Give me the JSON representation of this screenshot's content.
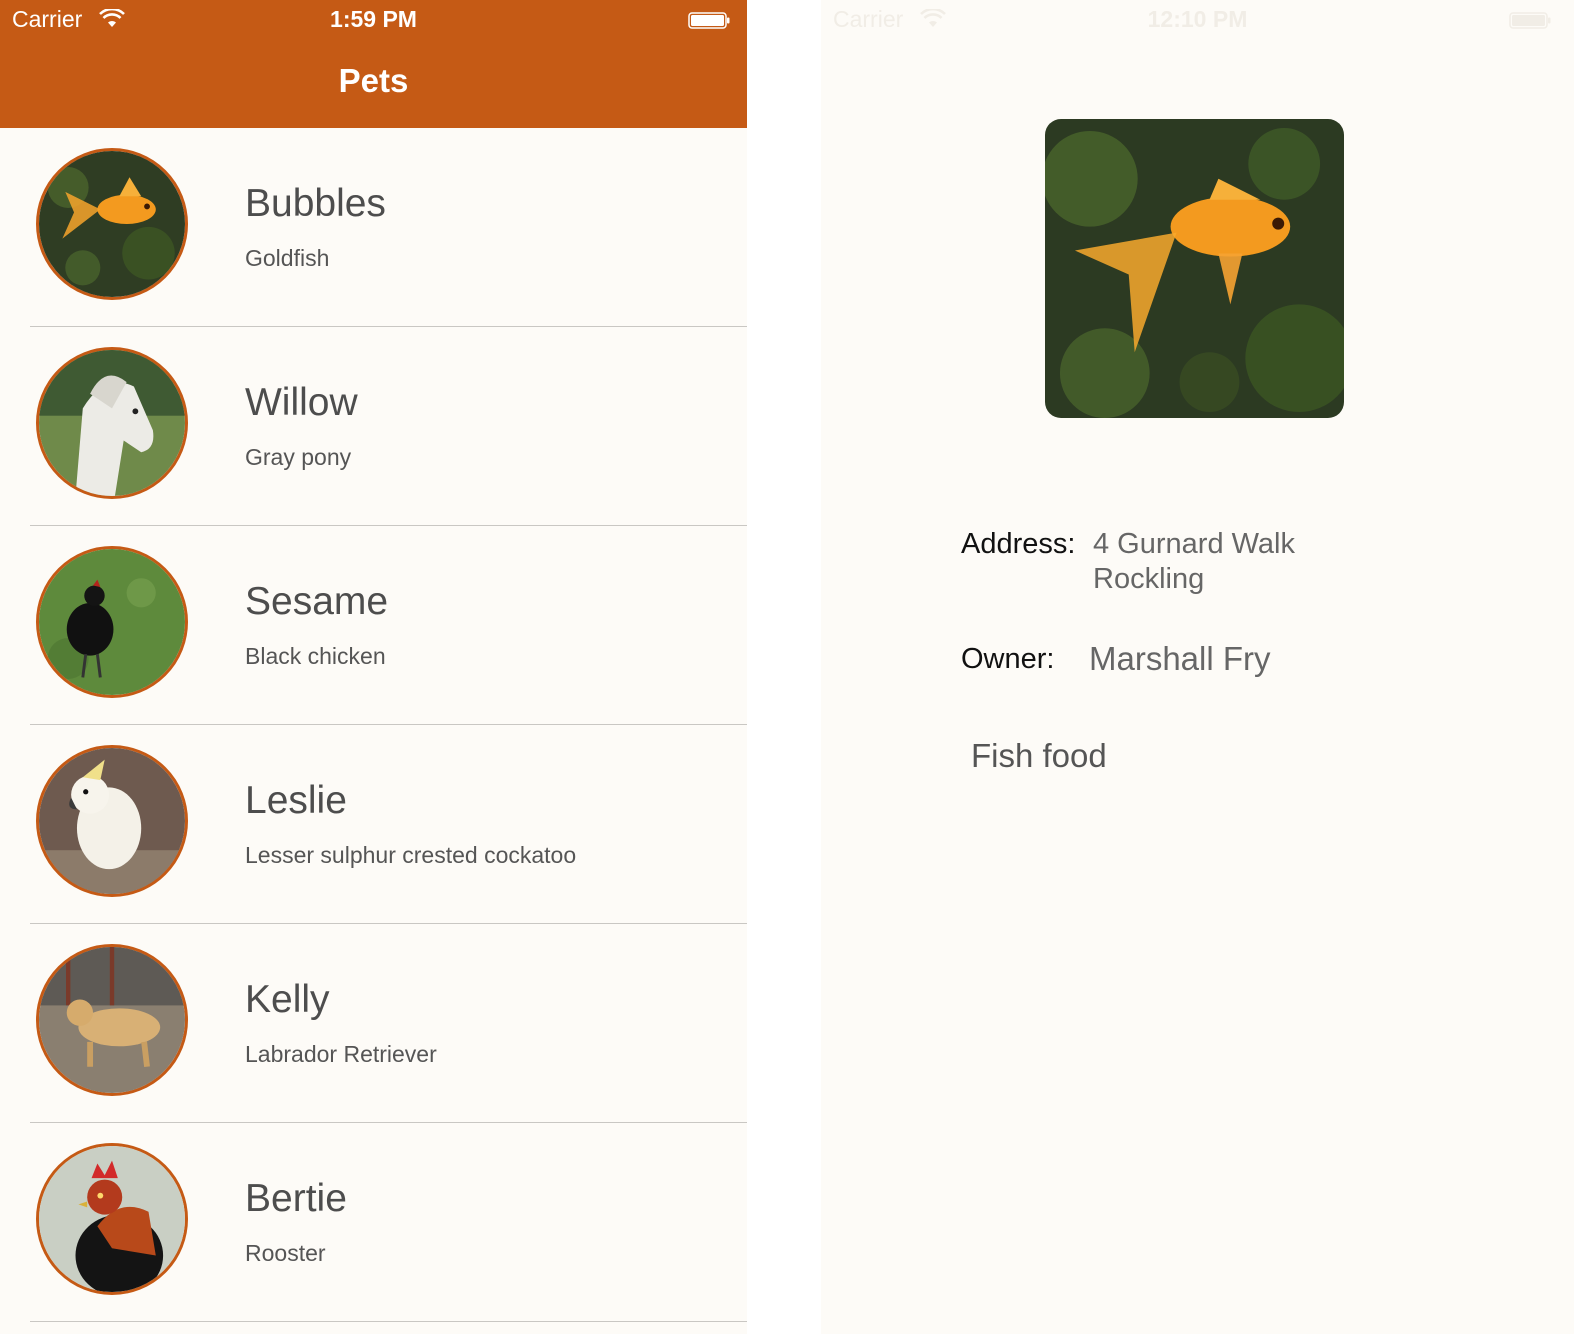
{
  "status_bar": {
    "carrier": "Carrier",
    "time": "1:59 PM"
  },
  "nav": {
    "title": "Pets"
  },
  "pets": [
    {
      "name": "Bubbles",
      "species": "Goldfish"
    },
    {
      "name": "Willow",
      "species": "Gray pony"
    },
    {
      "name": "Sesame",
      "species": "Black chicken"
    },
    {
      "name": "Leslie",
      "species": "Lesser sulphur crested cockatoo"
    },
    {
      "name": "Kelly",
      "species": "Labrador Retriever"
    },
    {
      "name": "Bertie",
      "species": "Rooster"
    }
  ],
  "detail_status_bar": {
    "carrier": "Carrier",
    "time": "12:10 PM"
  },
  "detail": {
    "address_label": "Address:",
    "address_line1": "4 Gurnard Walk",
    "address_line2": "Rockling",
    "owner_label": "Owner:",
    "owner": "Marshall Fry",
    "food": "Fish food"
  },
  "colors": {
    "accent": "#c55a15",
    "background": "#fdfbf7",
    "separator": "#c9c7c3"
  },
  "icons": [
    "wifi-icon",
    "battery-icon"
  ]
}
